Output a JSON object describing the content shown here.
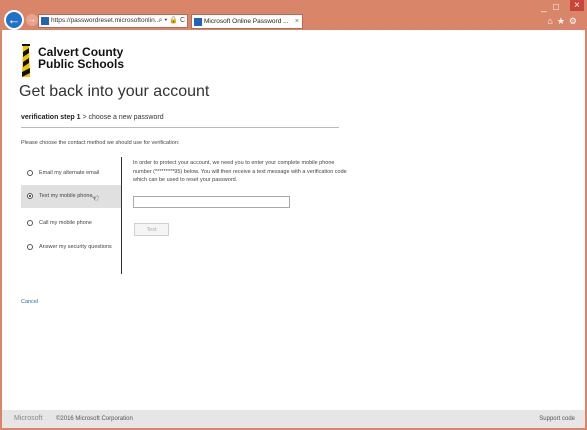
{
  "browser": {
    "address": "https://passwordreset.microsoftonlin...",
    "address_controls": "⌕ ▾ 🔒 C",
    "tab_title": "Microsoft Online Password ...",
    "toolbar_icons": [
      "home-icon",
      "star-icon",
      "gear-icon"
    ]
  },
  "window_controls": [
    "_",
    "□",
    "×"
  ],
  "logo": {
    "line1": "Calvert County",
    "line2": "Public Schools"
  },
  "page": {
    "title": "Get back into your account",
    "step_current": "verification step 1",
    "step_next": " > choose a new password",
    "instruction": "Please choose the contact method we should use for verification:",
    "options": [
      {
        "label": "Email my alternate email",
        "selected": false
      },
      {
        "label": "Text my mobile phone",
        "selected": true
      },
      {
        "label": "Call my mobile phone",
        "selected": false
      },
      {
        "label": "Answer my security questions",
        "selected": false
      }
    ],
    "description": "In order to protect your account, we need you to enter your complete mobile phone number (*********95) below. You will then receive a text message with a verification code which can be used to reset your password.",
    "phone_value": "",
    "text_button": "Text",
    "cancel": "Cancel"
  },
  "footer": {
    "brand": "Microsoft",
    "copyright": "©2016 Microsoft Corporation",
    "support": "Support code"
  },
  "colors": {
    "frame": "#d9856a",
    "accent": "#1e73c8",
    "link": "#1f6fb5"
  }
}
